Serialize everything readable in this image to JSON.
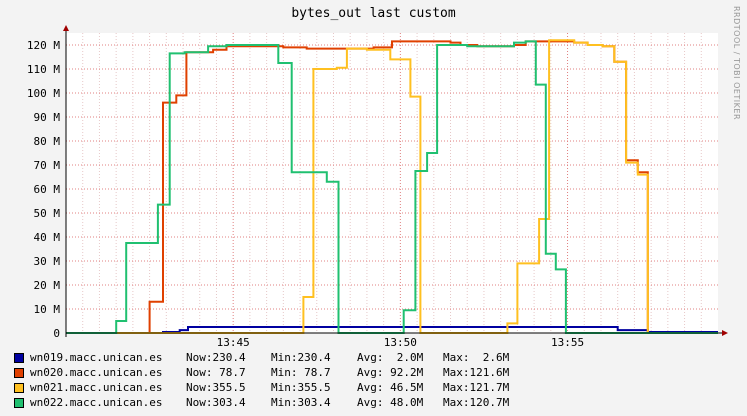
{
  "chart_data": {
    "type": "line",
    "title": "bytes_out last custom",
    "vendor": "RRDTOOL / TOBI OETIKER",
    "y_ticks": [
      {
        "v": 0,
        "label": "0"
      },
      {
        "v": 10,
        "label": "10 M"
      },
      {
        "v": 20,
        "label": "20 M"
      },
      {
        "v": 30,
        "label": "30 M"
      },
      {
        "v": 40,
        "label": "40 M"
      },
      {
        "v": 50,
        "label": "50 M"
      },
      {
        "v": 60,
        "label": "60 M"
      },
      {
        "v": 70,
        "label": "70 M"
      },
      {
        "v": 80,
        "label": "80 M"
      },
      {
        "v": 90,
        "label": "90 M"
      },
      {
        "v": 100,
        "label": "100 M"
      },
      {
        "v": 110,
        "label": "110 M"
      },
      {
        "v": 120,
        "label": "120 M"
      }
    ],
    "x_ticks": [
      {
        "t": 5,
        "label": "13:45"
      },
      {
        "t": 10,
        "label": "13:50"
      },
      {
        "t": 15,
        "label": "13:55"
      }
    ],
    "xlim": [
      0,
      19.5
    ],
    "ylim": [
      0,
      126
    ],
    "grid": true,
    "series": [
      {
        "name": "wn019.macc.unican.es",
        "color": "#0000a0",
        "legend": {
          "now": "Now:230.4",
          "min": "Min:230.4",
          "avg": "Avg:  2.0M",
          "max": "Max:  2.6M"
        },
        "points": [
          [
            0,
            0
          ],
          [
            2.9,
            0
          ],
          [
            2.9,
            0.4
          ],
          [
            3.4,
            0.4
          ],
          [
            3.4,
            1.2
          ],
          [
            3.65,
            1.2
          ],
          [
            3.65,
            2.5
          ],
          [
            16.5,
            2.5
          ],
          [
            16.5,
            1.2
          ],
          [
            17.4,
            1.2
          ],
          [
            17.4,
            0.4
          ],
          [
            19.5,
            0.4
          ]
        ]
      },
      {
        "name": "wn020.macc.unican.es",
        "color": "#e04000",
        "legend": {
          "now": "Now: 78.7",
          "min": "Min: 78.7",
          "avg": "Avg: 92.2M",
          "max": "Max:121.6M"
        },
        "points": [
          [
            0,
            0
          ],
          [
            2.5,
            0
          ],
          [
            2.5,
            13
          ],
          [
            2.9,
            13
          ],
          [
            2.9,
            96
          ],
          [
            3.3,
            96
          ],
          [
            3.3,
            99
          ],
          [
            3.6,
            99
          ],
          [
            3.6,
            117
          ],
          [
            4.4,
            117
          ],
          [
            4.4,
            118
          ],
          [
            4.8,
            118
          ],
          [
            4.8,
            119.5
          ],
          [
            6.5,
            119.5
          ],
          [
            6.5,
            119
          ],
          [
            7.2,
            119
          ],
          [
            7.2,
            118.5
          ],
          [
            9.2,
            118.5
          ],
          [
            9.2,
            119
          ],
          [
            9.75,
            119
          ],
          [
            9.75,
            121.5
          ],
          [
            11.5,
            121.5
          ],
          [
            11.5,
            121
          ],
          [
            11.8,
            121
          ],
          [
            11.8,
            120
          ],
          [
            12.3,
            120
          ],
          [
            12.3,
            119.5
          ],
          [
            13.4,
            119.5
          ],
          [
            13.4,
            120
          ],
          [
            13.75,
            120
          ],
          [
            13.75,
            121.5
          ],
          [
            15.2,
            121.5
          ],
          [
            15.2,
            121
          ],
          [
            15.6,
            121
          ],
          [
            15.6,
            120
          ],
          [
            16.05,
            120
          ],
          [
            16.05,
            119.5
          ],
          [
            16.4,
            119.5
          ],
          [
            16.4,
            113
          ],
          [
            16.75,
            113
          ],
          [
            16.75,
            72
          ],
          [
            17.1,
            72
          ],
          [
            17.1,
            67
          ],
          [
            17.4,
            67
          ],
          [
            17.4,
            0
          ],
          [
            19.5,
            0
          ]
        ]
      },
      {
        "name": "wn021.macc.unican.es",
        "color": "#ffc020",
        "legend": {
          "now": "Now:355.5",
          "min": "Min:355.5",
          "avg": "Avg: 46.5M",
          "max": "Max:121.7M"
        },
        "points": [
          [
            0,
            0
          ],
          [
            7.1,
            0
          ],
          [
            7.1,
            15
          ],
          [
            7.4,
            15
          ],
          [
            7.4,
            110
          ],
          [
            8.1,
            110
          ],
          [
            8.1,
            110.5
          ],
          [
            8.4,
            110.5
          ],
          [
            8.4,
            118.5
          ],
          [
            9.0,
            118.5
          ],
          [
            9.0,
            118
          ],
          [
            9.7,
            118
          ],
          [
            9.7,
            114
          ],
          [
            10.3,
            114
          ],
          [
            10.3,
            98.5
          ],
          [
            10.6,
            98.5
          ],
          [
            10.6,
            0
          ],
          [
            13.2,
            0
          ],
          [
            13.2,
            4
          ],
          [
            13.5,
            4
          ],
          [
            13.5,
            29
          ],
          [
            14.15,
            29
          ],
          [
            14.15,
            47.5
          ],
          [
            14.45,
            47.5
          ],
          [
            14.45,
            122
          ],
          [
            15.2,
            122
          ],
          [
            15.2,
            121
          ],
          [
            15.6,
            121
          ],
          [
            15.6,
            120
          ],
          [
            16.05,
            120
          ],
          [
            16.05,
            119.5
          ],
          [
            16.4,
            119.5
          ],
          [
            16.4,
            113
          ],
          [
            16.75,
            113
          ],
          [
            16.75,
            71
          ],
          [
            17.1,
            71
          ],
          [
            17.1,
            66
          ],
          [
            17.4,
            66
          ],
          [
            17.4,
            0
          ],
          [
            19.5,
            0
          ]
        ]
      },
      {
        "name": "wn022.macc.unican.es",
        "color": "#20c070",
        "legend": {
          "now": "Now:303.4",
          "min": "Min:303.4",
          "avg": "Avg: 48.0M",
          "max": "Max:120.7M"
        },
        "points": [
          [
            0,
            0
          ],
          [
            1.5,
            0
          ],
          [
            1.5,
            5
          ],
          [
            1.8,
            5
          ],
          [
            1.8,
            37.5
          ],
          [
            2.75,
            37.5
          ],
          [
            2.75,
            53.5
          ],
          [
            3.1,
            53.5
          ],
          [
            3.1,
            116.5
          ],
          [
            3.55,
            116.5
          ],
          [
            3.55,
            117
          ],
          [
            4.25,
            117
          ],
          [
            4.25,
            119.5
          ],
          [
            4.8,
            119.5
          ],
          [
            4.8,
            120
          ],
          [
            6.35,
            120
          ],
          [
            6.35,
            112.5
          ],
          [
            6.75,
            112.5
          ],
          [
            6.75,
            67
          ],
          [
            7.8,
            67
          ],
          [
            7.8,
            63
          ],
          [
            8.15,
            63
          ],
          [
            8.15,
            0
          ],
          [
            10.1,
            0
          ],
          [
            10.1,
            9.5
          ],
          [
            10.45,
            9.5
          ],
          [
            10.45,
            67.5
          ],
          [
            10.8,
            67.5
          ],
          [
            10.8,
            75
          ],
          [
            11.1,
            75
          ],
          [
            11.1,
            120
          ],
          [
            12.0,
            120
          ],
          [
            12.0,
            119.5
          ],
          [
            13.4,
            119.5
          ],
          [
            13.4,
            121
          ],
          [
            13.75,
            121
          ],
          [
            13.75,
            121.5
          ],
          [
            14.05,
            121.5
          ],
          [
            14.05,
            103.5
          ],
          [
            14.35,
            103.5
          ],
          [
            14.35,
            33
          ],
          [
            14.65,
            33
          ],
          [
            14.65,
            26.5
          ],
          [
            14.95,
            26.5
          ],
          [
            14.95,
            0
          ],
          [
            19.5,
            0
          ]
        ]
      }
    ]
  }
}
